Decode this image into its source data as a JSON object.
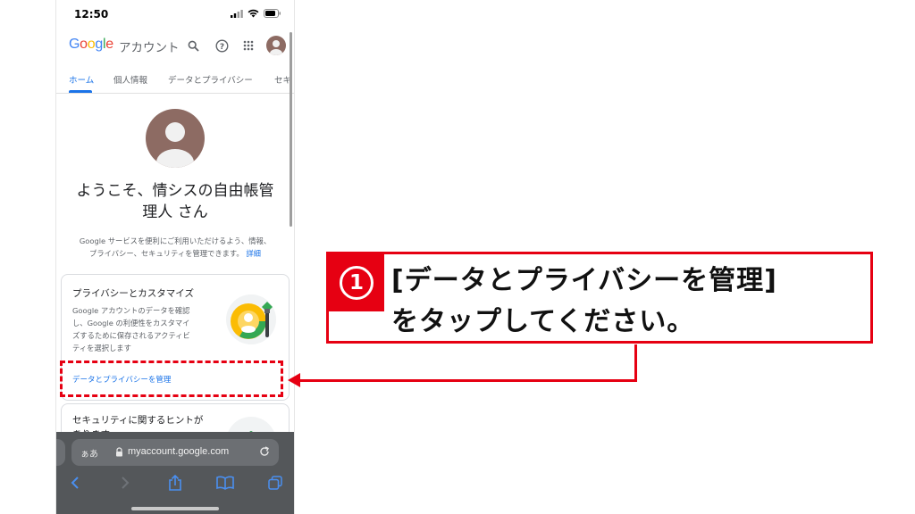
{
  "status_bar": {
    "time": "12:50"
  },
  "header": {
    "logo_letters": [
      "G",
      "o",
      "o",
      "g",
      "l",
      "e"
    ],
    "logo_suffix": "アカウント",
    "icons": [
      "search-icon",
      "help-icon",
      "apps-grid-icon",
      "avatar"
    ]
  },
  "tabs": [
    {
      "label": "ホーム",
      "active": true
    },
    {
      "label": "個人情報",
      "active": false
    },
    {
      "label": "データとプライバシー",
      "active": false
    },
    {
      "label": "セキ",
      "active": false
    }
  ],
  "welcome": {
    "line1": "ようこそ、情シスの自由帳管",
    "line2": "理人 さん"
  },
  "intro": {
    "line1": "Google サービスを便利にご利用いただけるよう、情報、",
    "line2": "プライバシー、セキュリティを管理できます。",
    "link": "詳細"
  },
  "privacy_card": {
    "title": "プライバシーとカスタマイズ",
    "body_lines": [
      "Google アカウントのデータを確認",
      "し、Google の利便性をカスタマイ",
      "ズするために保存されるアクティビ",
      "ティを選択します"
    ],
    "link": "データとプライバシーを管理"
  },
  "security_card": {
    "title_line1": "セキュリティに関するヒントが",
    "title_line2": "あります"
  },
  "safari": {
    "aa": "ぁあ",
    "url": "myaccount.google.com"
  },
  "callout": {
    "badge": "1",
    "line1": "[データとプライバシーを管理]",
    "line2": "をタップしてください。"
  },
  "colors": {
    "accent_red": "#e60012",
    "link_blue": "#1a73e8"
  }
}
